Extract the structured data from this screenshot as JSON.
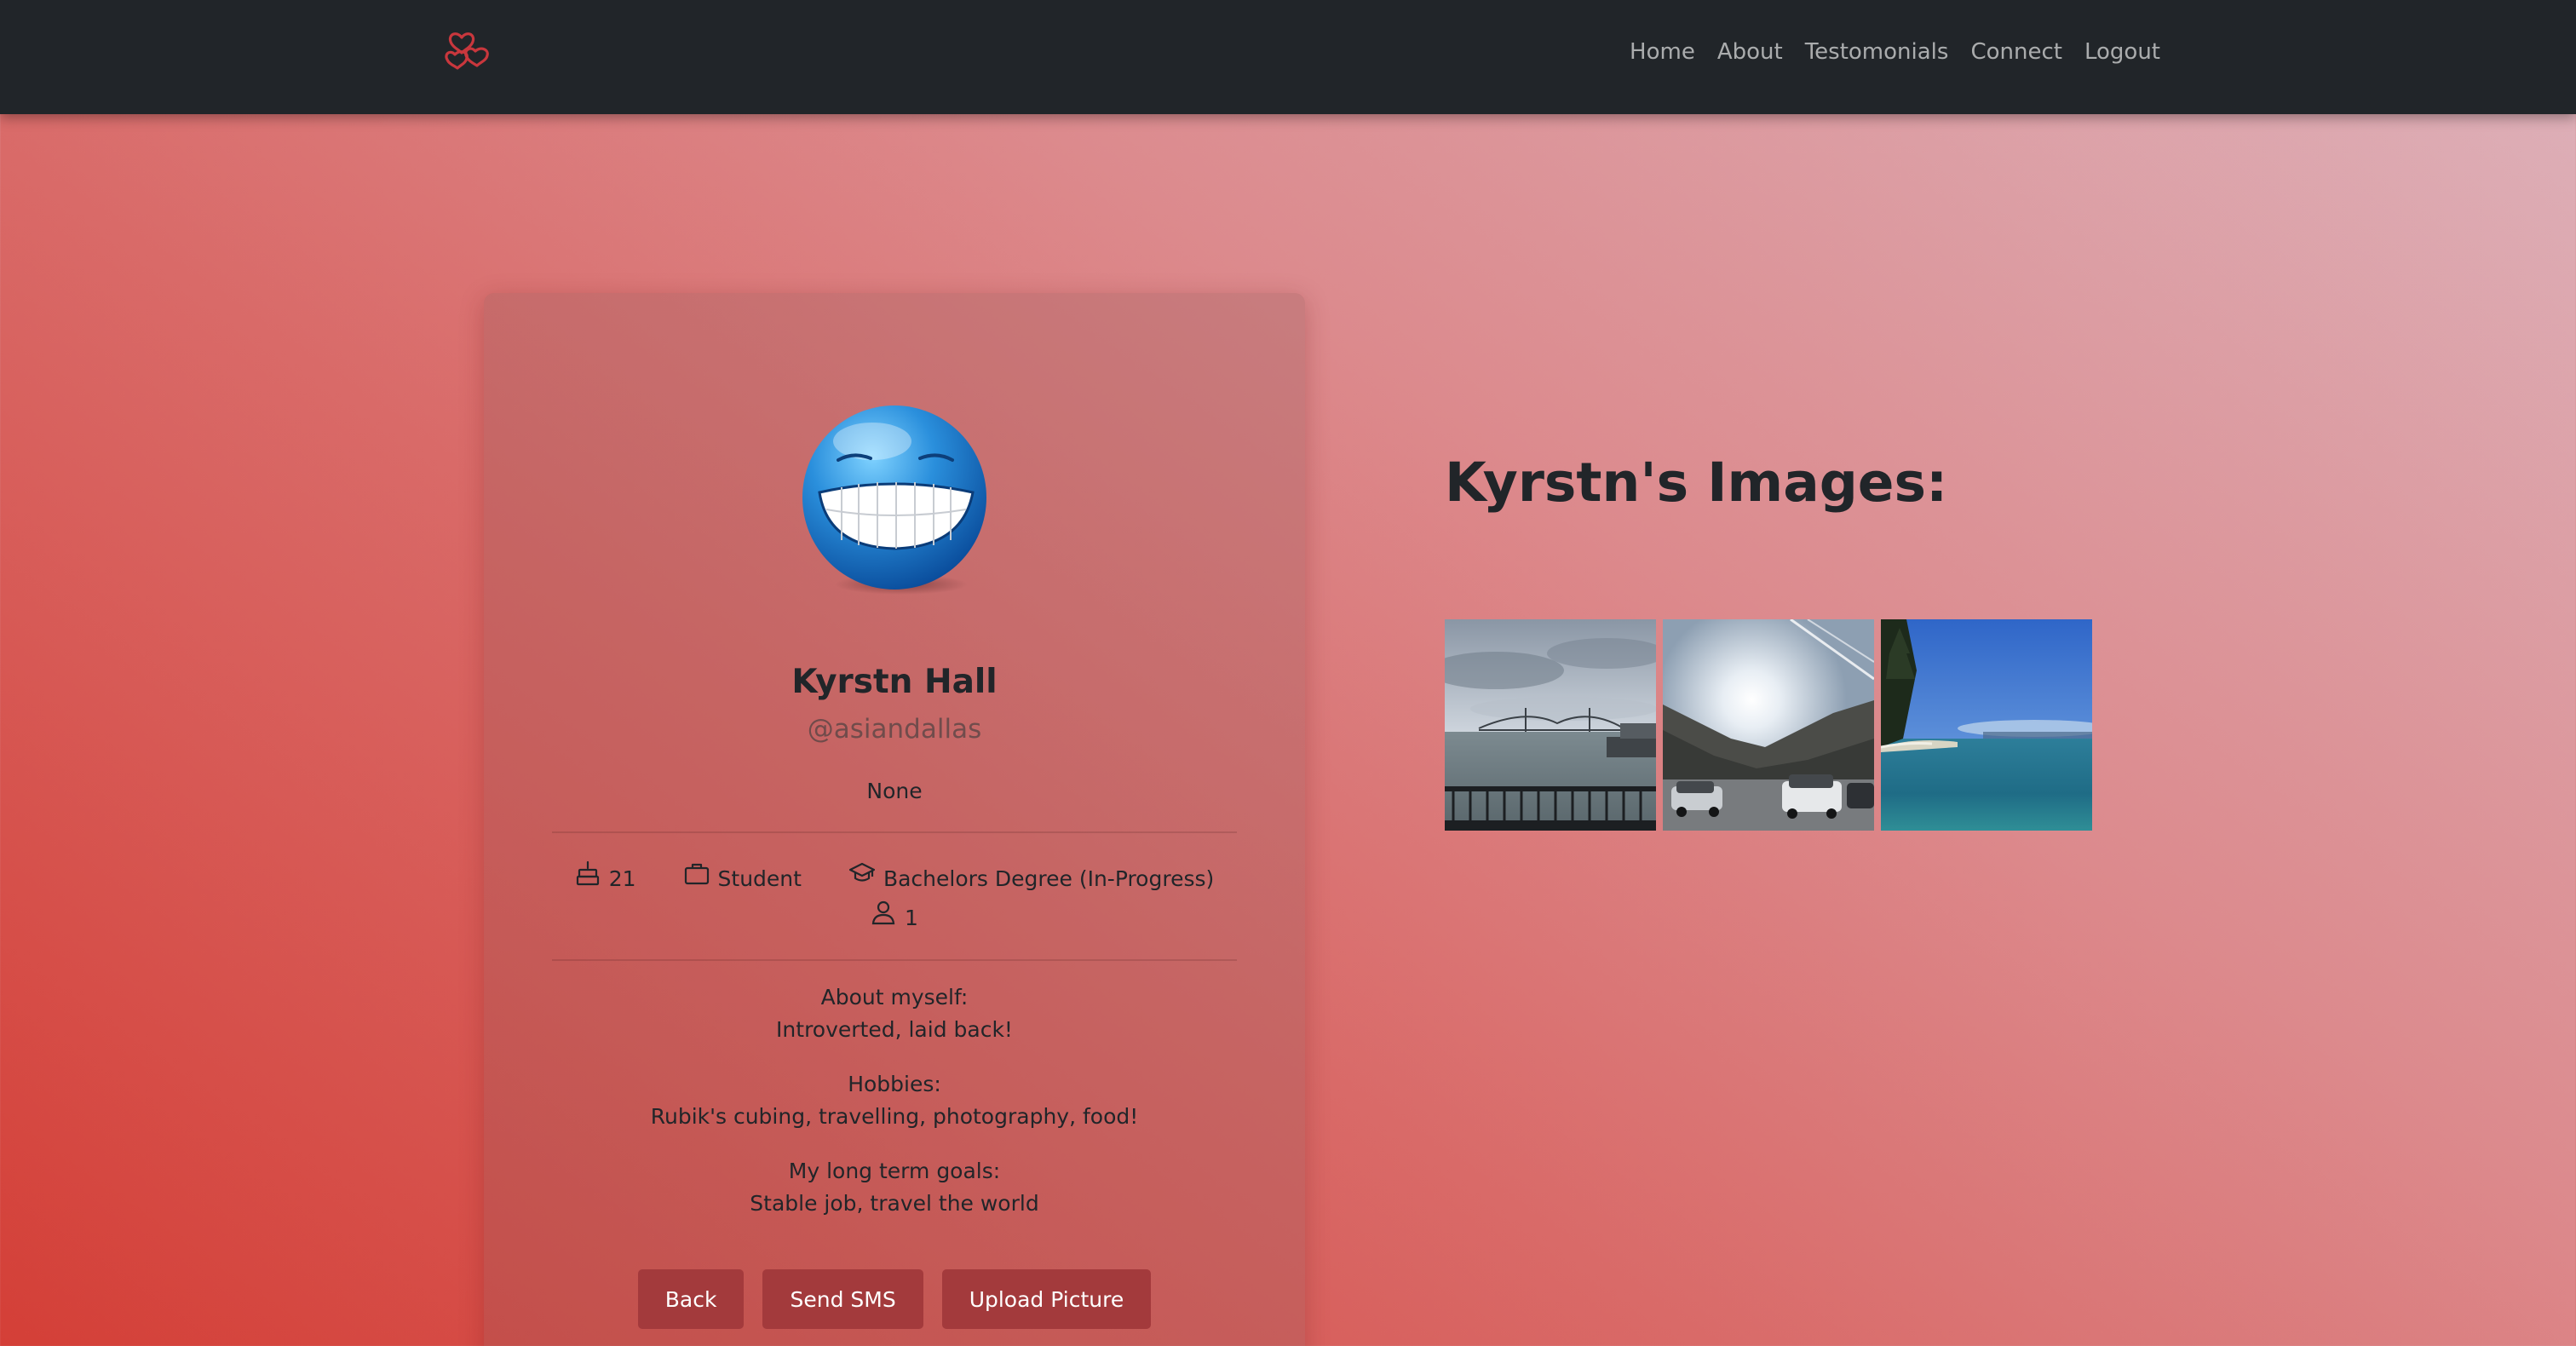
{
  "nav": {
    "brand_icon": "hearts-logo-icon",
    "links": [
      "Home",
      "About",
      "Testomonials",
      "Connect",
      "Logout"
    ]
  },
  "profile": {
    "avatar_icon": "grinning-face-avatar",
    "name": "Kyrstn Hall",
    "handle": "@asiandallas",
    "status": "None",
    "stats": {
      "age": "21",
      "occupation": "Student",
      "education": "Bachelors Degree (In-Progress)",
      "count": "1"
    },
    "about_label": "About myself:",
    "about_text": "Introverted, laid back!",
    "hobbies_label": "Hobbies:",
    "hobbies_text": "Rubik's cubing, travelling, photography, food!",
    "goals_label": "My long term goals:",
    "goals_text": "Stable job, travel the world"
  },
  "buttons": {
    "back": "Back",
    "send_sms": "Send SMS",
    "upload": "Upload Picture"
  },
  "gallery": {
    "title": "Kyrstn's Images:",
    "photos": [
      "bay-bridge-pier-photo",
      "mountain-parking-lot-photo",
      "lake-shore-photo"
    ]
  },
  "colors": {
    "navbar": "#212529",
    "button": "#a33a3c",
    "accent_logo": "#c9373d"
  }
}
